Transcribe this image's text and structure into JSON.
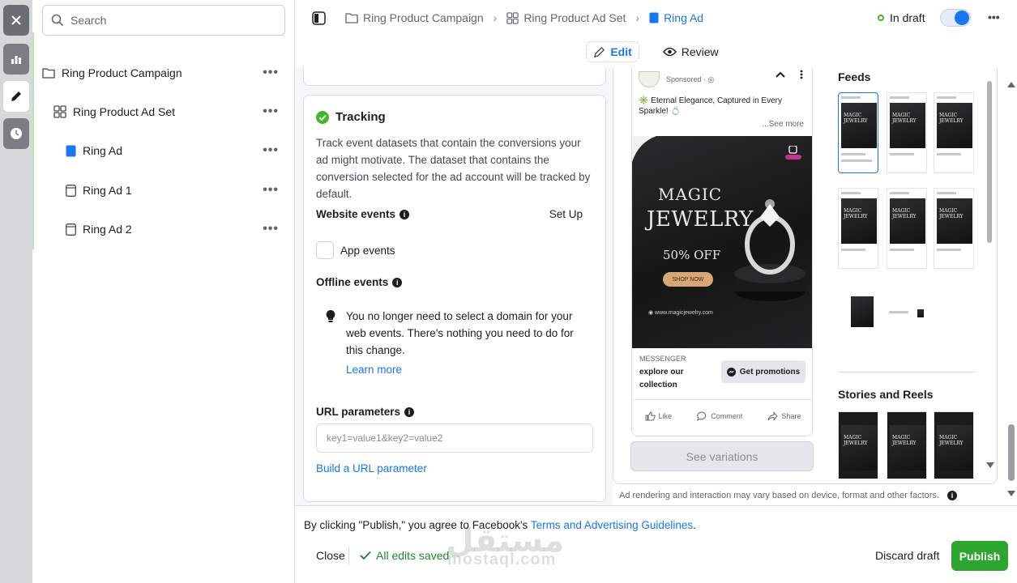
{
  "rail": {
    "icons": [
      "close-icon",
      "chart-icon",
      "pencil-icon",
      "clock-icon"
    ]
  },
  "search": {
    "placeholder": "Search"
  },
  "tree": {
    "items": [
      {
        "label": "Ring Product Campaign",
        "icon": "folder-icon"
      },
      {
        "label": "Ring Product Ad Set",
        "icon": "grid-icon"
      },
      {
        "label": "Ring Ad",
        "icon": "ad-filled-icon"
      },
      {
        "label": "Ring Ad 1",
        "icon": "ad-outline-icon"
      },
      {
        "label": "Ring Ad 2",
        "icon": "ad-outline-icon"
      }
    ],
    "more": "•••"
  },
  "breadcrumb": {
    "campaign": "Ring Product Campaign",
    "adset": "Ring Product Ad Set",
    "ad": "Ring Ad",
    "sep": "›"
  },
  "status": {
    "label": "In draft",
    "more": "•••"
  },
  "modes": {
    "edit": "Edit",
    "review": "Review"
  },
  "tracking": {
    "title": "Tracking",
    "description": "Track event datasets that contain the conversions your ad might motivate. The dataset that contains the conversion selected for the ad account will be tracked by default.",
    "website_events": "Website events",
    "setup": "Set Up",
    "app_events": "App events",
    "offline_events": "Offline events",
    "tip": "You no longer need to select a domain for your web events. There's nothing you need to do for this change.",
    "learn_more": "Learn more",
    "url_params": "URL parameters",
    "url_placeholder": "key1=value1&key2=value2",
    "build_url": "Build a URL parameter",
    "info": "i"
  },
  "preview": {
    "sponsored": "Sponsored · ◎",
    "primary_text": "✳️ Eternal Elegance, Captured in Every Sparkle! 💍",
    "see_more": "...See more",
    "image": {
      "line1": "MAGIC",
      "line2": "JEWELRY",
      "offer": "50% OFF",
      "shop": "SHOP NOW",
      "site": "◉ www.magicjewelry.com"
    },
    "cta_source": "MESSENGER",
    "headline": "explore our collection",
    "cta": "Get promotions",
    "actions": {
      "like": "Like",
      "comment": "Comment",
      "share": "Share"
    },
    "see_variations": "See variations",
    "feeds_title": "Feeds",
    "stories_title": "Stories and Reels",
    "thumb_text": "MAGIC JEWELRY",
    "disclaimer": "Ad rendering and interaction may vary based on device, format and other factors."
  },
  "footer": {
    "terms_prefix": "By clicking \"Publish,\" you agree to Facebook's ",
    "terms_link": "Terms and Advertising Guidelines",
    "terms_suffix": ".",
    "close": "Close",
    "saved": "All edits saved",
    "discard": "Discard draft",
    "publish": "Publish",
    "watermark": "مستقل",
    "watermark_latin": "mostaql.com"
  },
  "colors": {
    "accent": "#1877f2",
    "success": "#2ea52e",
    "draft_dot": "#42b72a"
  }
}
